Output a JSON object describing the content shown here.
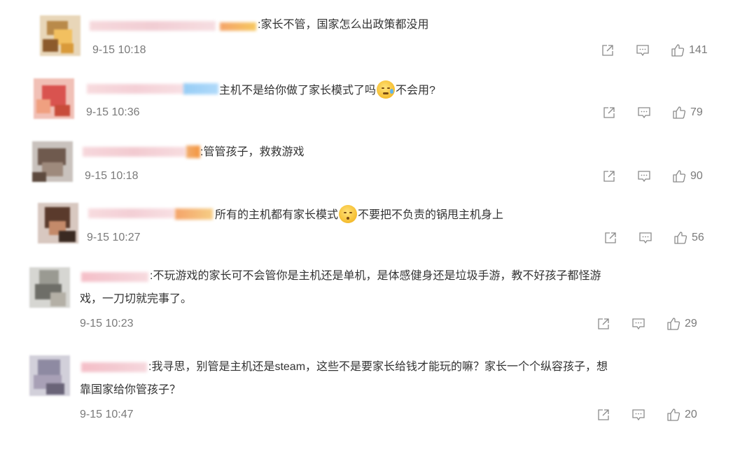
{
  "comments": [
    {
      "separator": ":",
      "text": "家长不管，国家怎么出政策都没用",
      "time": "9-15 10:18",
      "likes": "141"
    },
    {
      "separator": "",
      "text_before": "主机不是给你做了家长模式了吗",
      "emoji": "sweat-smile-emoji",
      "text_after": "不会用?",
      "time": "9-15 10:36",
      "likes": "79"
    },
    {
      "separator": ":",
      "text": "管管孩子，救救游戏",
      "time": "9-15 10:18",
      "likes": "90"
    },
    {
      "separator": "",
      "text_before": "所有的主机都有家长模式",
      "emoji": "shush-emoji",
      "text_after": "不要把不负责的锅甩主机身上",
      "time": "9-15 10:27",
      "likes": "56"
    },
    {
      "separator": ":",
      "text": "不玩游戏的家长可不会管你是主机还是单机，是体感健身还是垃圾手游，教不好孩子都怪游",
      "text_cont": "戏，一刀切就完事了。",
      "time": "9-15 10:23",
      "likes": "29"
    },
    {
      "separator": ":",
      "text": "我寻思，别管是主机还是steam，这些不是要家长给钱才能玩的嘛？家长一个个纵容孩子，想",
      "text_cont": "靠国家给你管孩子？",
      "time": "9-15 10:47",
      "likes": "20"
    }
  ],
  "icons": {
    "share": "share-icon",
    "comment": "comment-icon",
    "like": "thumbs-up-icon"
  },
  "colors": {
    "text": "#333333",
    "meta": "#7a7a7a",
    "icon": "#8a8a8a"
  }
}
